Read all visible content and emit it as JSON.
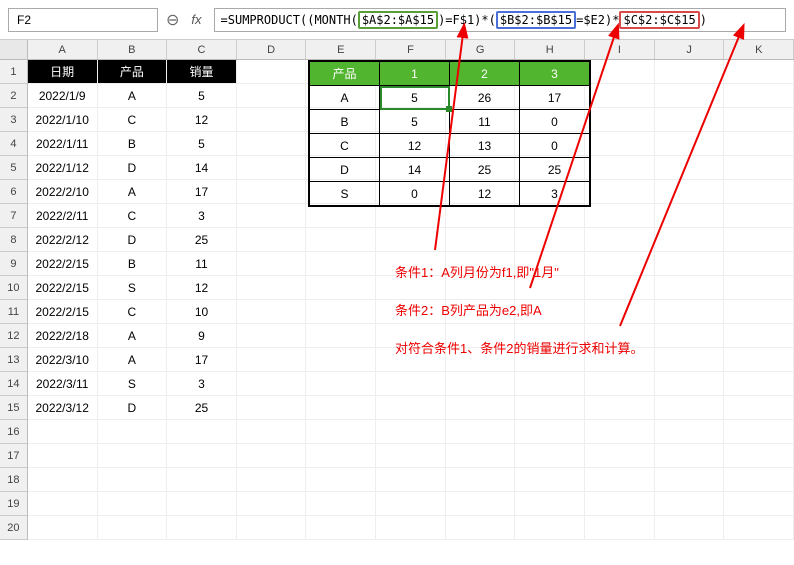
{
  "cell_ref": "F2",
  "formula_text": "=SUMPRODUCT((MONTH($A$2:$A$15)=F$1)*($B$2:$B$15=$E2)*$C$2:$C$15)",
  "formula_parts": {
    "p1": "=SUMPRODUCT((MONTH(",
    "r1": "$A$2:$A$15",
    "p2": ")=F$1)*(",
    "r2": "$B$2:$B$15",
    "p3": "=$E2)*",
    "r3": "$C$2:$C$15",
    "p4": ")"
  },
  "cols": [
    "A",
    "B",
    "C",
    "D",
    "E",
    "F",
    "G",
    "H",
    "I",
    "J",
    "K"
  ],
  "data_headers": {
    "a": "日期",
    "b": "产品",
    "c": "销量"
  },
  "rows": [
    {
      "n": "1"
    },
    {
      "n": "2",
      "a": "2022/1/9",
      "b": "A",
      "c": "5"
    },
    {
      "n": "3",
      "a": "2022/1/10",
      "b": "C",
      "c": "12"
    },
    {
      "n": "4",
      "a": "2022/1/11",
      "b": "B",
      "c": "5"
    },
    {
      "n": "5",
      "a": "2022/1/12",
      "b": "D",
      "c": "14"
    },
    {
      "n": "6",
      "a": "2022/2/10",
      "b": "A",
      "c": "17"
    },
    {
      "n": "7",
      "a": "2022/2/11",
      "b": "C",
      "c": "3"
    },
    {
      "n": "8",
      "a": "2022/2/12",
      "b": "D",
      "c": "25"
    },
    {
      "n": "9",
      "a": "2022/2/15",
      "b": "B",
      "c": "11"
    },
    {
      "n": "10",
      "a": "2022/2/15",
      "b": "S",
      "c": "12"
    },
    {
      "n": "11",
      "a": "2022/2/15",
      "b": "C",
      "c": "10"
    },
    {
      "n": "12",
      "a": "2022/2/18",
      "b": "A",
      "c": "9"
    },
    {
      "n": "13",
      "a": "2022/3/10",
      "b": "A",
      "c": "17"
    },
    {
      "n": "14",
      "a": "2022/3/11",
      "b": "S",
      "c": "3"
    },
    {
      "n": "15",
      "a": "2022/3/12",
      "b": "D",
      "c": "25"
    },
    {
      "n": "16"
    },
    {
      "n": "17"
    },
    {
      "n": "18"
    },
    {
      "n": "19"
    },
    {
      "n": "20"
    }
  ],
  "summary": {
    "corner": "产品",
    "cols": [
      "1",
      "2",
      "3"
    ],
    "rows": [
      {
        "p": "A",
        "v": [
          "5",
          "26",
          "17"
        ]
      },
      {
        "p": "B",
        "v": [
          "5",
          "11",
          "0"
        ]
      },
      {
        "p": "C",
        "v": [
          "12",
          "13",
          "0"
        ]
      },
      {
        "p": "D",
        "v": [
          "14",
          "25",
          "25"
        ]
      },
      {
        "p": "S",
        "v": [
          "0",
          "12",
          "3"
        ]
      }
    ]
  },
  "annotations": {
    "l1": "条件1：A列月份为f1,即\"1月\"",
    "l2": "条件2：B列产品为e2,即A",
    "l3": "对符合条件1、条件2的销量进行求和计算。"
  },
  "chart_data": {
    "type": "table",
    "title": "SUMPRODUCT按月份和产品汇总销量",
    "source_columns": [
      "日期",
      "产品",
      "销量"
    ],
    "source_rows": [
      [
        "2022/1/9",
        "A",
        5
      ],
      [
        "2022/1/10",
        "C",
        12
      ],
      [
        "2022/1/11",
        "B",
        5
      ],
      [
        "2022/1/12",
        "D",
        14
      ],
      [
        "2022/2/10",
        "A",
        17
      ],
      [
        "2022/2/11",
        "C",
        3
      ],
      [
        "2022/2/12",
        "D",
        25
      ],
      [
        "2022/2/15",
        "B",
        11
      ],
      [
        "2022/2/15",
        "S",
        12
      ],
      [
        "2022/2/15",
        "C",
        10
      ],
      [
        "2022/2/18",
        "A",
        9
      ],
      [
        "2022/3/10",
        "A",
        17
      ],
      [
        "2022/3/11",
        "S",
        3
      ],
      [
        "2022/3/12",
        "D",
        25
      ]
    ],
    "pivot": {
      "row_field": "产品",
      "col_field": "月份",
      "categories_cols": [
        1,
        2,
        3
      ],
      "categories_rows": [
        "A",
        "B",
        "C",
        "D",
        "S"
      ],
      "values": [
        [
          5,
          26,
          17
        ],
        [
          5,
          11,
          0
        ],
        [
          12,
          13,
          0
        ],
        [
          14,
          25,
          25
        ],
        [
          0,
          12,
          3
        ]
      ]
    }
  }
}
